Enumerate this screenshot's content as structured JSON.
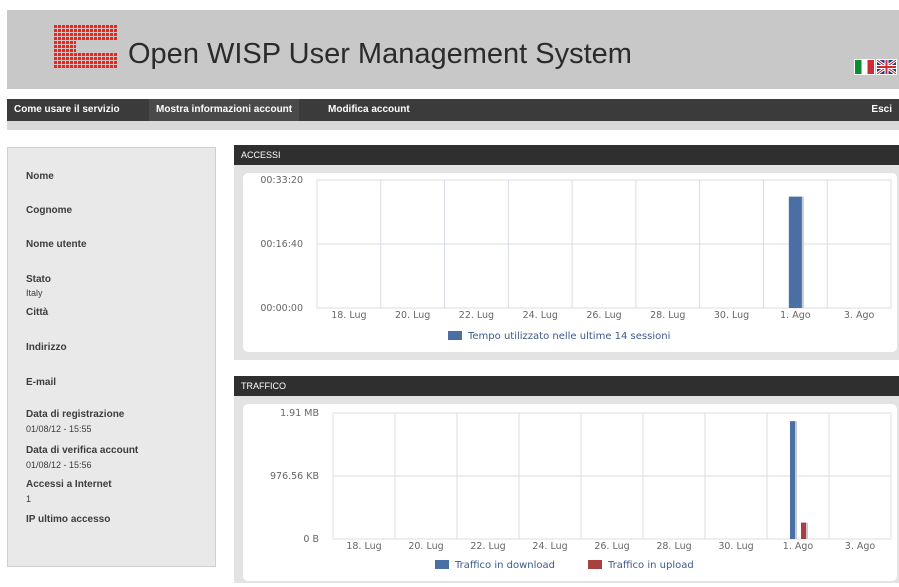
{
  "header": {
    "title": "Open WISP User Management System"
  },
  "flags": [
    "flag-italy-icon",
    "flag-uk-icon"
  ],
  "nav": {
    "items": [
      "Come usare il servizio",
      "Mostra informazioni account",
      "Modifica account"
    ],
    "logout": "Esci"
  },
  "sidebar": {
    "fields": [
      {
        "label": "Nome",
        "value": ""
      },
      {
        "label": "Cognome",
        "value": ""
      },
      {
        "label": "Nome utente",
        "value": ""
      },
      {
        "label": "Stato",
        "value": "Italy"
      },
      {
        "label": "Città",
        "value": ""
      },
      {
        "label": "Indirizzo",
        "value": ""
      },
      {
        "label": "E-mail",
        "value": ""
      },
      {
        "label": "Data di registrazione",
        "value": "01/08/12 - 15:55"
      },
      {
        "label": "Data di verifica account",
        "value": "01/08/12 - 15:56"
      },
      {
        "label": "Accessi a Internet",
        "value": "1"
      },
      {
        "label": "IP ultimo accesso",
        "value": ""
      }
    ]
  },
  "panels": {
    "accessi": "ACCESSI",
    "traffico": "TRAFFICO"
  },
  "colors": {
    "download": "#4a6fa5",
    "upload": "#a8403f",
    "nav": "#3b3b3b"
  },
  "chart_data": [
    {
      "type": "bar",
      "title": "ACCESSI",
      "categories": [
        "18. Lug",
        "20. Lug",
        "22. Lug",
        "24. Lug",
        "26. Lug",
        "28. Lug",
        "30. Lug",
        "1. Ago",
        "3. Ago"
      ],
      "y_ticks": [
        "00:00:00",
        "00:16:40",
        "00:33:20"
      ],
      "ylim": [
        0,
        2000
      ],
      "series": [
        {
          "name": "Tempo utilizzato nelle ultime 14 sessioni",
          "x": "1. Ago",
          "value": 1740
        }
      ]
    },
    {
      "type": "bar",
      "title": "TRAFFICO",
      "categories": [
        "18. Lug",
        "20. Lug",
        "22. Lug",
        "24. Lug",
        "26. Lug",
        "28. Lug",
        "30. Lug",
        "1. Ago",
        "3. Ago"
      ],
      "y_ticks": [
        "0 B",
        "976.56 KB",
        "1.91 MB"
      ],
      "ylim": [
        0,
        2000
      ],
      "series": [
        {
          "name": "Traffico in download",
          "x": "1. Ago",
          "value": 1870
        },
        {
          "name": "Traffico in upload",
          "x": "1. Ago",
          "value": 260
        }
      ]
    }
  ]
}
